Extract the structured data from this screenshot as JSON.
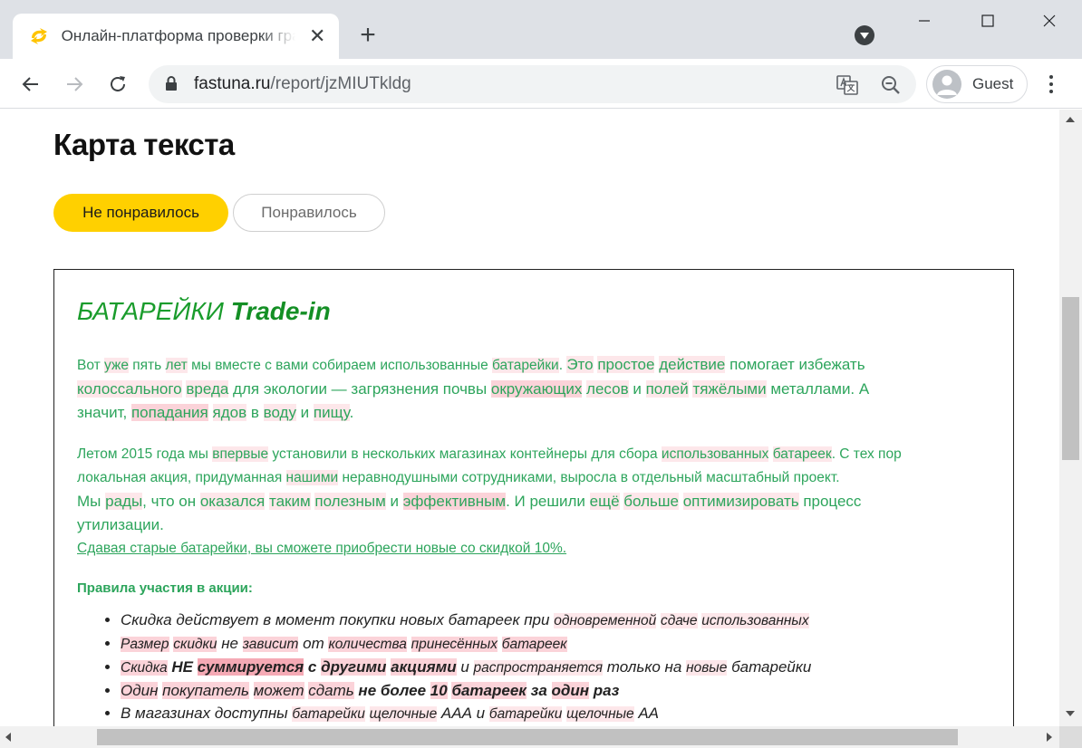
{
  "browser": {
    "tab_title": "Онлайн-платформа проверки грамматики",
    "url_domain": "fastuna.ru",
    "url_path": "/report/jzMIUTkldg",
    "profile_label": "Guest"
  },
  "page": {
    "title": "Карта текста",
    "dislike_label": "Не понравилось",
    "like_label": "Понравилось"
  },
  "textmap": {
    "heading_regular": "БАТАРЕЙКИ ",
    "heading_bold": "Trade-in",
    "p1": [
      [
        "Вот ",
        ""
      ],
      [
        "уже",
        "h1"
      ],
      [
        " пять ",
        ""
      ],
      [
        "лет",
        "h1"
      ],
      [
        " мы вместе с вами собираем использованные ",
        ""
      ],
      [
        "батарейки",
        "h1"
      ],
      [
        ". ",
        ""
      ],
      [
        "Это",
        "h1"
      ],
      [
        " ",
        ""
      ],
      [
        "простое",
        "h1"
      ],
      [
        " ",
        ""
      ],
      [
        "действие",
        "h1"
      ],
      [
        " помогает избежать",
        ""
      ]
    ],
    "p1_line2": [
      [
        "колоссального",
        "h1"
      ],
      [
        " ",
        ""
      ],
      [
        "вреда",
        "h1"
      ],
      [
        " для экологии — загрязнения почвы ",
        ""
      ],
      [
        "окружающих",
        "h2"
      ],
      [
        " ",
        ""
      ],
      [
        "лесов",
        "h1"
      ],
      [
        " и ",
        ""
      ],
      [
        "полей",
        "h1"
      ],
      [
        " ",
        ""
      ],
      [
        "тяжёлыми",
        "h1"
      ],
      [
        " металлами. А",
        ""
      ]
    ],
    "p1_line3": [
      [
        "значит, ",
        ""
      ],
      [
        "попадания",
        "h2"
      ],
      [
        " ",
        ""
      ],
      [
        "ядов",
        "h1"
      ],
      [
        " в ",
        ""
      ],
      [
        "воду",
        "h1"
      ],
      [
        " и ",
        ""
      ],
      [
        "пищу",
        "h1"
      ],
      [
        ".",
        ""
      ]
    ],
    "p2_line1": [
      [
        "Летом 2015 года мы ",
        ""
      ],
      [
        "впервые",
        "h1"
      ],
      [
        " установили в нескольких магазинах контейнеры для сбора ",
        ""
      ],
      [
        "использованных",
        "h1"
      ],
      [
        " ",
        ""
      ],
      [
        "батареек",
        "h1"
      ],
      [
        ". С тех пор",
        ""
      ]
    ],
    "p2_line2": [
      [
        "локальная акция, придуманная ",
        ""
      ],
      [
        "нашими",
        "h1"
      ],
      [
        " неравнодушными сотрудниками, выросла в отдельный масштабный проект.",
        ""
      ]
    ],
    "p2_line3": [
      [
        "Мы ",
        ""
      ],
      [
        "рады",
        "h1"
      ],
      [
        ", что он ",
        ""
      ],
      [
        "оказался",
        "h1"
      ],
      [
        " ",
        ""
      ],
      [
        "таким",
        "h1"
      ],
      [
        " ",
        ""
      ],
      [
        "полезным",
        "h1"
      ],
      [
        " и ",
        ""
      ],
      [
        "эффективным",
        "h2"
      ],
      [
        ". И решили ",
        ""
      ],
      [
        "ещё",
        "h1"
      ],
      [
        " ",
        ""
      ],
      [
        "больше",
        "h1"
      ],
      [
        " ",
        ""
      ],
      [
        "оптимизировать",
        "h1"
      ],
      [
        " процесс",
        ""
      ]
    ],
    "p2_line4": [
      [
        "утилизации.",
        ""
      ]
    ],
    "link_text": "Сдавая старые батарейки, вы сможете приобрести новые со скидкой 10%.",
    "rules_heading": "Правила участия в акции:",
    "rules": [
      [
        [
          " Скидка действует в момент покупки новых батареек при ",
          "",
          0,
          0
        ],
        [
          "одновременной",
          "h1",
          0,
          1
        ],
        [
          " ",
          "",
          0,
          0
        ],
        [
          "сдаче",
          "h1",
          0,
          1
        ],
        [
          " ",
          "",
          0,
          0
        ],
        [
          "использованных",
          "h1",
          0,
          1
        ]
      ],
      [
        [
          " Размер",
          "h2",
          0,
          1
        ],
        [
          " ",
          "",
          0,
          0
        ],
        [
          "скидки",
          "h2",
          0,
          1
        ],
        [
          " не ",
          "",
          0,
          0
        ],
        [
          "зависит",
          "h2",
          0,
          1
        ],
        [
          " от ",
          "",
          0,
          0
        ],
        [
          "количества",
          "h2",
          0,
          1
        ],
        [
          " ",
          "",
          0,
          0
        ],
        [
          "принесённых",
          "h2",
          0,
          1
        ],
        [
          " ",
          "",
          0,
          0
        ],
        [
          "батареек",
          "h2",
          0,
          1
        ]
      ],
      [
        [
          "Скидка",
          "h2",
          0,
          1
        ],
        [
          " ",
          "",
          0,
          0
        ],
        [
          "НЕ",
          "",
          1,
          0
        ],
        [
          " ",
          "",
          0,
          0
        ],
        [
          "суммируется",
          "h3",
          1,
          0
        ],
        [
          " ",
          "",
          0,
          0
        ],
        [
          "с",
          "",
          1,
          0
        ],
        [
          " ",
          "",
          0,
          0
        ],
        [
          "другими",
          "h2",
          1,
          0
        ],
        [
          " ",
          "",
          0,
          0
        ],
        [
          "акциями",
          "h2",
          1,
          0
        ],
        [
          " и ",
          "",
          0,
          0
        ],
        [
          "распространяется",
          "h1",
          0,
          1
        ],
        [
          " только на ",
          "",
          0,
          0
        ],
        [
          "новые",
          "h1",
          0,
          1
        ],
        [
          " батарейки",
          "",
          0,
          0
        ]
      ],
      [
        [
          "Один",
          "h2",
          0,
          0
        ],
        [
          " ",
          "",
          0,
          0
        ],
        [
          "покупатель",
          "h2",
          0,
          0
        ],
        [
          " ",
          "",
          0,
          0
        ],
        [
          "может",
          "h2",
          0,
          0
        ],
        [
          " ",
          "",
          0,
          0
        ],
        [
          "сдать",
          "h2",
          0,
          0
        ],
        [
          " ",
          "",
          0,
          0
        ],
        [
          "не более",
          "",
          1,
          0
        ],
        [
          " ",
          "",
          0,
          0
        ],
        [
          "10",
          "h2",
          1,
          0
        ],
        [
          " ",
          "",
          0,
          0
        ],
        [
          "батареек",
          "h2",
          1,
          0
        ],
        [
          " ",
          "",
          0,
          0
        ],
        [
          "за",
          "",
          1,
          0
        ],
        [
          " ",
          "",
          0,
          0
        ],
        [
          "один",
          "h2",
          1,
          0
        ],
        [
          " ",
          "",
          0,
          0
        ],
        [
          "раз",
          "",
          1,
          0
        ]
      ],
      [
        [
          "В магазинах доступны ",
          "",
          0,
          0
        ],
        [
          "батарейки",
          "h1",
          0,
          1
        ],
        [
          " ",
          "",
          0,
          0
        ],
        [
          "щелочные",
          "h1",
          0,
          1
        ],
        [
          " ААА и ",
          "",
          0,
          0
        ],
        [
          "батарейки",
          "h1",
          0,
          1
        ],
        [
          " ",
          "",
          0,
          0
        ],
        [
          "щелочные",
          "h1",
          0,
          1
        ],
        [
          " АА",
          "",
          0,
          0
        ]
      ]
    ]
  }
}
